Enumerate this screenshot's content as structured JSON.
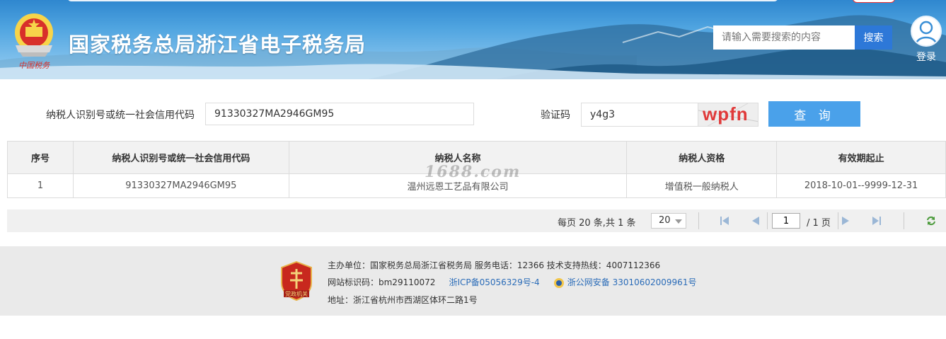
{
  "header": {
    "title": "国家税务总局浙江省电子税务局",
    "search_placeholder": "请输入需要搜索的内容",
    "search_button": "搜索",
    "login_label": "登录",
    "emblem_caption": "中国税务"
  },
  "query": {
    "taxpayer_id_label": "纳税人识别号或统一社会信用代码",
    "taxpayer_id_value": "91330327MA2946GM95",
    "captcha_label": "验证码",
    "captcha_value": "y4g3",
    "captcha_image_text": "wpfn",
    "query_button": "查 询"
  },
  "table": {
    "headers": [
      "序号",
      "纳税人识别号或统一社会信用代码",
      "纳税人名称",
      "纳税人资格",
      "有效期起止"
    ],
    "rows": [
      [
        "1",
        "91330327MA2946GM95",
        "温州远恩工艺品有限公司",
        "增值税一般纳税人",
        "2018-10-01--9999-12-31"
      ]
    ]
  },
  "watermark": "1688.com",
  "pagination": {
    "summary": "每页 20 条,共 1 条",
    "page_size": "20",
    "current_page": "1",
    "total_pages": "/ 1 页"
  },
  "footer": {
    "line1": "主办单位：国家税务总局浙江省税务局    服务电话：12366    技术支持热线：4007112366",
    "site_id": "网站标识码：bm29110072",
    "icp": "浙ICP备05056329号-4",
    "police": "浙公网安备 33010602009961号",
    "address": "地址：浙江省杭州市西湖区体环二路1号",
    "badge_text": "党政机关"
  },
  "colors": {
    "header_blue": "#3a93d8",
    "button_blue": "#4aa1ea",
    "search_button": "#2d78d8",
    "captcha_red": "#e03a3a",
    "link_blue": "#2b6cb8"
  }
}
